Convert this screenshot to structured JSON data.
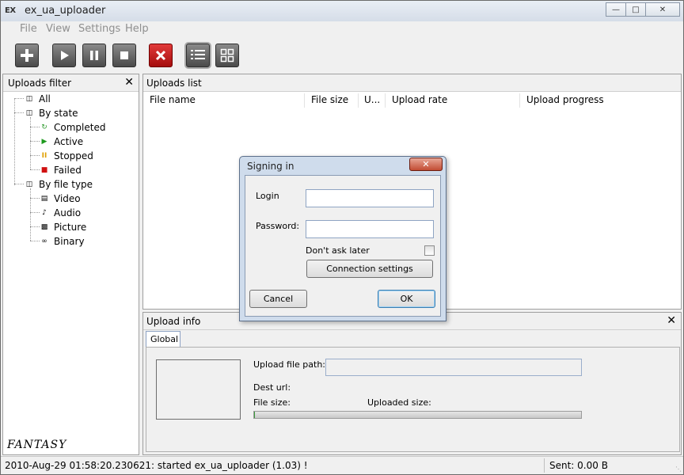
{
  "window": {
    "title": "ex_ua_uploader",
    "icon_text": "EX"
  },
  "menu": [
    "File",
    "View",
    "Settings",
    "Help"
  ],
  "toolbar": {
    "colors": {
      "dark": "#555555",
      "red": "#c41414"
    }
  },
  "filter_panel": {
    "title": "Uploads filter",
    "tree": {
      "all": "All",
      "by_state": "By state",
      "states": [
        "Completed",
        "Active",
        "Stopped",
        "Failed"
      ],
      "by_file_type": "By file type",
      "types": [
        "Video",
        "Audio",
        "Picture",
        "Binary"
      ]
    },
    "logo_text": "FANTASY"
  },
  "uploads_list": {
    "title": "Uploads list",
    "columns": [
      "File name",
      "File size",
      "U...",
      "Upload rate",
      "Upload progress"
    ]
  },
  "upload_info": {
    "title": "Upload info",
    "tab": "Global",
    "upload_file_path_label": "Upload file path:",
    "dest_url_label": "Dest url:",
    "file_size_label": "File size:",
    "uploaded_size_label": "Uploaded size:",
    "progress_fraction": 0.0
  },
  "dialog": {
    "title": "Signing in",
    "login_label": "Login",
    "password_label": "Password:",
    "login_value": "",
    "password_value": "",
    "dont_ask_label": "Don't ask later",
    "connection_settings": "Connection settings",
    "cancel": "Cancel",
    "ok": "OK"
  },
  "status": {
    "message": "2010-Aug-29 01:58:20.230621: started ex_ua_uploader (1.03) !",
    "sent": "Sent: 0.00 B"
  }
}
